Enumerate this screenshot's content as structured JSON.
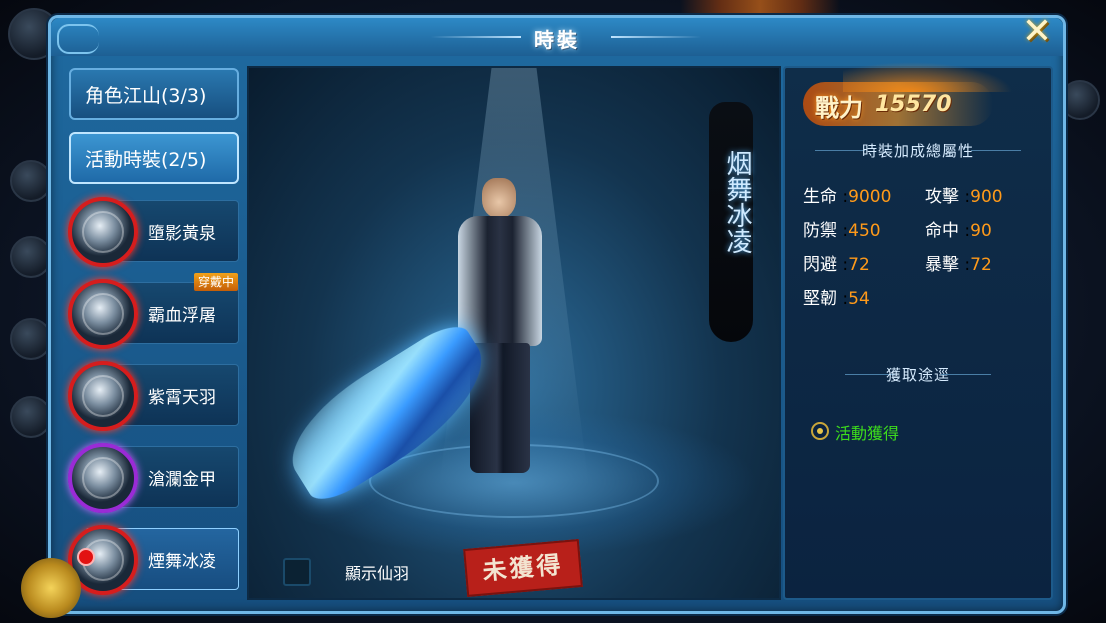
{
  "window": {
    "title": "時裝",
    "close_icon": "close-icon"
  },
  "sidebar": {
    "categories": [
      {
        "label": "角色江山(3/3)"
      },
      {
        "label": "活動時裝(2/5)"
      }
    ],
    "items": [
      {
        "label": "墮影黃泉",
        "frame": "red"
      },
      {
        "label": "霸血浮屠",
        "frame": "red",
        "badge": "穿戴中"
      },
      {
        "label": "紫霄天羽",
        "frame": "red"
      },
      {
        "label": "滄瀾金甲",
        "frame": "purple"
      },
      {
        "label": "煙舞冰凌",
        "frame": "red"
      }
    ]
  },
  "stage": {
    "costume_name": "烟舞冰凌",
    "show_wings_label": "顯示仙羽",
    "status_stamp": "未獲得"
  },
  "info": {
    "power_label": "戰力",
    "power_value": "15570",
    "attributes_title": "時裝加成總屬性",
    "stats": [
      {
        "name": "生命",
        "value": "9000"
      },
      {
        "name": "攻擊",
        "value": "900"
      },
      {
        "name": "防禦",
        "value": "450"
      },
      {
        "name": "命中",
        "value": "90"
      },
      {
        "name": "閃避",
        "value": "72"
      },
      {
        "name": "暴擊",
        "value": "72"
      },
      {
        "name": "堅韌",
        "value": "54"
      }
    ],
    "acquire_title": "獲取途逕",
    "acquire_method": "活動獲得"
  },
  "colors": {
    "stat_value": "#ff9a1a",
    "acquire_text": "#3ddc1c",
    "frame_red": "#d61d1d",
    "frame_purple": "#9a2bd6"
  }
}
